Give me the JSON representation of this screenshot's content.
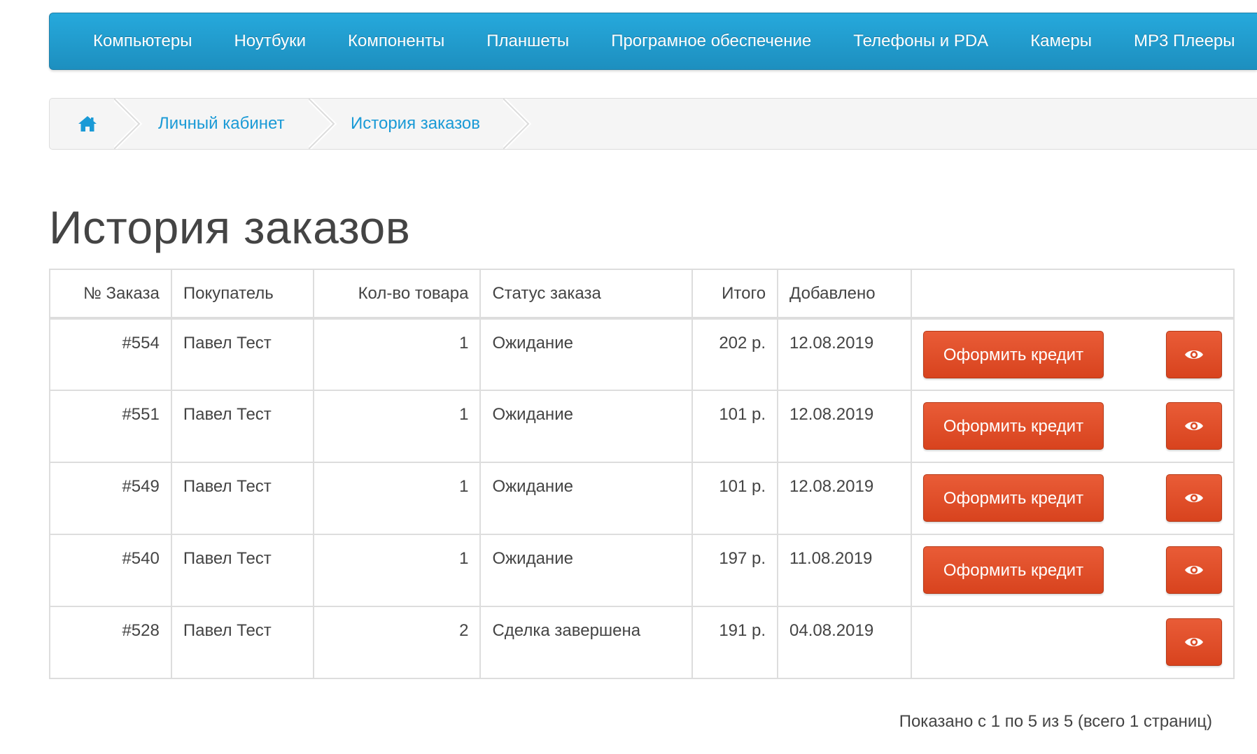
{
  "nav": {
    "items": [
      {
        "label": "Компьютеры"
      },
      {
        "label": "Ноутбуки"
      },
      {
        "label": "Компоненты"
      },
      {
        "label": "Планшеты"
      },
      {
        "label": "Програмное обеспечение"
      },
      {
        "label": "Телефоны и PDA"
      },
      {
        "label": "Камеры"
      },
      {
        "label": "MP3 Плееры"
      }
    ],
    "color": "#229bcf"
  },
  "breadcrumb": {
    "home_icon": "home-icon",
    "items": [
      {
        "label": "Личный кабинет"
      },
      {
        "label": "История заказов"
      }
    ]
  },
  "page": {
    "title": "История заказов"
  },
  "table": {
    "headers": {
      "order_id": "№ Заказа",
      "customer": "Покупатель",
      "qty": "Кол-во товара",
      "status": "Статус заказа",
      "total": "Итого",
      "date": "Добавлено"
    },
    "rows": [
      {
        "order_id": "#554",
        "customer": "Павел Тест",
        "qty": "1",
        "status": "Ожидание",
        "total": "202 р.",
        "date": "12.08.2019",
        "credit_label": "Оформить кредит"
      },
      {
        "order_id": "#551",
        "customer": "Павел Тест",
        "qty": "1",
        "status": "Ожидание",
        "total": "101 р.",
        "date": "12.08.2019",
        "credit_label": "Оформить кредит"
      },
      {
        "order_id": "#549",
        "customer": "Павел Тест",
        "qty": "1",
        "status": "Ожидание",
        "total": "101 р.",
        "date": "12.08.2019",
        "credit_label": "Оформить кредит"
      },
      {
        "order_id": "#540",
        "customer": "Павел Тест",
        "qty": "1",
        "status": "Ожидание",
        "total": "197 р.",
        "date": "11.08.2019",
        "credit_label": "Оформить кредит"
      },
      {
        "order_id": "#528",
        "customer": "Павел Тест",
        "qty": "2",
        "status": "Сделка завершена",
        "total": "191 р.",
        "date": "04.08.2019",
        "credit_label": null
      }
    ],
    "view_icon": "eye-icon",
    "button_color": "#e04f2a"
  },
  "pagination": {
    "info": "Показано с 1 по 5 из 5 (всего 1 страниц)"
  }
}
